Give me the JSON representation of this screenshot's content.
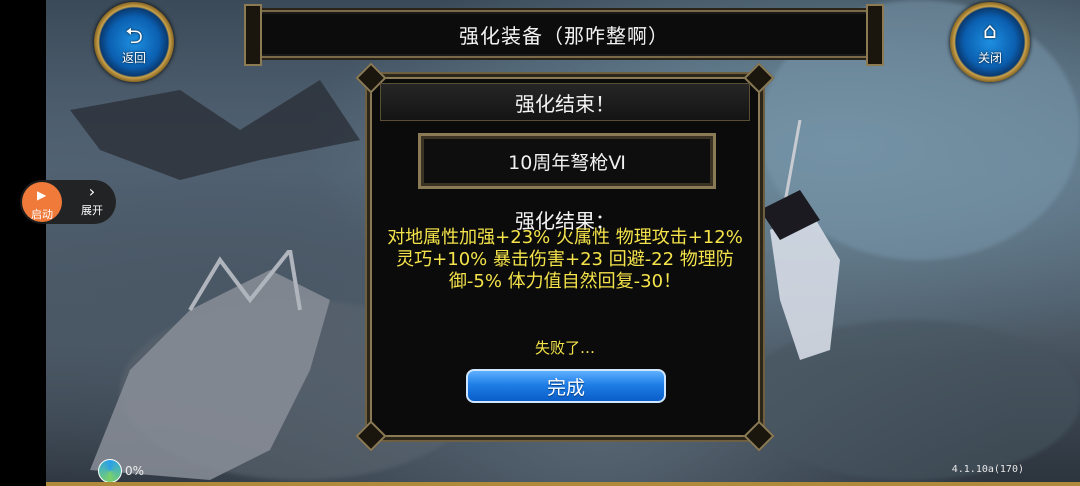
{
  "header": {
    "title": "强化装备（那咋整啊）",
    "back_label": "返回",
    "close_label": "关闭"
  },
  "dialog": {
    "header": "强化结束！",
    "item_name": "10周年弩枪Ⅵ",
    "result_title": "强化结果：",
    "result_text": "对地属性加强+23% 火属性 物理攻击+12% 灵巧+10% 暴击伤害+23 回避-22 物理防御-5% 体力值自然回复-30！",
    "status": "失败了…",
    "confirm_label": "完成"
  },
  "float_menu": {
    "start_label": "启动",
    "expand_label": "展开"
  },
  "footer": {
    "progress_text": "0%",
    "version": "4.1.10a(170)"
  },
  "icons": {
    "back": "back-arrow-icon",
    "close": "home-icon",
    "start": "play-icon",
    "expand": "chevron-right-icon"
  }
}
